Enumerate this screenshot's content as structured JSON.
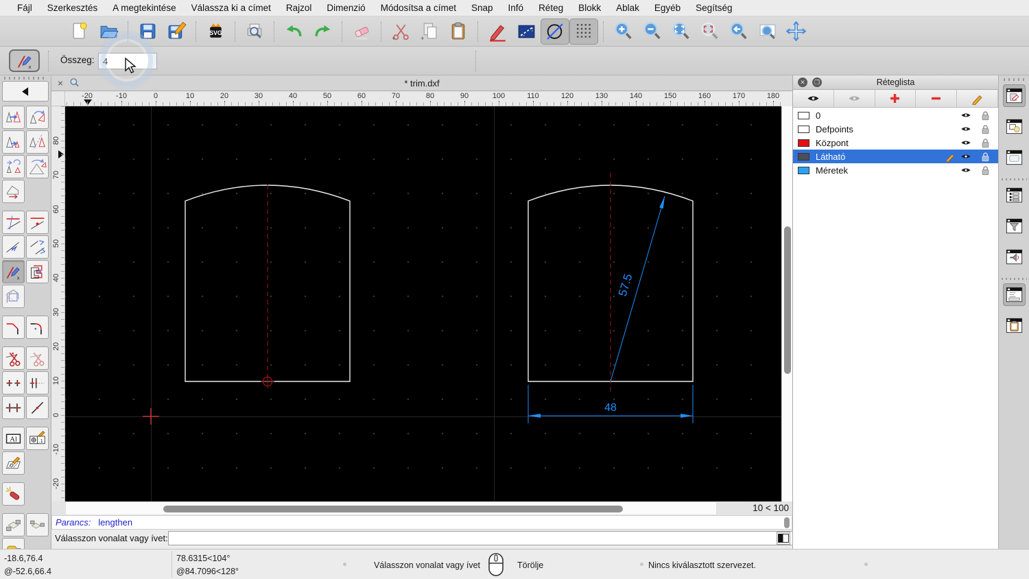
{
  "menu_items": [
    "Fájl",
    "Szerkesztés",
    "A megtekintése",
    "Válassza ki a címet",
    "Rajzol",
    "Dimenzió",
    "Módosítsa a címet",
    "Snap",
    "Infó",
    "Réteg",
    "Blokk",
    "Ablak",
    "Egyéb",
    "Segítség"
  ],
  "toolbar": {
    "icons": [
      "new",
      "open",
      "sep",
      "save",
      "save-as",
      "sep",
      "svg-export",
      "sep",
      "print-preview",
      "sep",
      "undo",
      "redo",
      "sep",
      "eraser",
      "sep",
      "cut",
      "copy",
      "paste",
      "sep",
      "pen",
      "measure",
      "draft-mode:pressed",
      "grid:pressed",
      "sep",
      "zoom-in",
      "zoom-out",
      "zoom-auto",
      "zoom-select",
      "zoom-previous",
      "zoom-window",
      "pan"
    ]
  },
  "tool_options": {
    "tool": "lengthen",
    "label": "Összeg:",
    "value": "4"
  },
  "tab_bar": {
    "title": "* trim.dxf",
    "close_glyph": "×"
  },
  "ruler_h": [
    "-20",
    "-10",
    "0",
    "10",
    "20",
    "30",
    "40",
    "50",
    "60",
    "70",
    "80",
    "90",
    "100",
    "110",
    "120",
    "130",
    "140",
    "150",
    "160",
    "170",
    "180"
  ],
  "ruler_v": [
    "80",
    "70",
    "60",
    "50",
    "40",
    "30",
    "20",
    "10",
    "0",
    "-10",
    "-20"
  ],
  "canvas": {
    "zoom_label": "10 < 100",
    "dim_diagonal": "57.5",
    "dim_width": "48"
  },
  "palette": {
    "rows": [
      [
        "move",
        "rotate"
      ],
      [
        "scale",
        "mirror"
      ],
      [
        "move-rotate",
        "rotate-two"
      ],
      [
        "revert-direction",
        null
      ],
      "gap",
      [
        "trim",
        "trim-two"
      ],
      [
        "lengthen-extend",
        "lengthen-both"
      ],
      [
        "lengthen:pressed",
        "offset"
      ],
      [
        "bevel-detail",
        null
      ],
      "gap",
      [
        "bevel",
        "fillet"
      ],
      "gap",
      [
        "divide",
        "divide-frozen"
      ],
      [
        "stretch",
        "stretch-two"
      ],
      [
        "stretch-three",
        "break-point"
      ],
      "gap",
      [
        "text-edit",
        "dim-edit"
      ],
      [
        "hatch-edit",
        null
      ],
      "gap",
      [
        "explode",
        null
      ],
      "gap",
      [
        "block-edit",
        "block-copy"
      ],
      [
        "paint",
        null
      ]
    ]
  },
  "layer_panel": {
    "title": "Réteglista",
    "toolbar_icons": [
      "eye-all",
      "eye-none",
      "add-layer",
      "remove-layer",
      "edit-layer"
    ],
    "layers": [
      {
        "name": "0",
        "color": "#ffffff",
        "selected": false,
        "pencil": false
      },
      {
        "name": "Defpoints",
        "color": "#ffffff",
        "selected": false,
        "pencil": false
      },
      {
        "name": "Központ",
        "color": "#e51010",
        "selected": false,
        "pencil": false
      },
      {
        "name": "Látható",
        "color": "#4a5058",
        "selected": true,
        "pencil": true
      },
      {
        "name": "Méretek",
        "color": "#29a3f3",
        "selected": false,
        "pencil": false
      }
    ]
  },
  "dock": {
    "buttons": [
      "dock-layers:pressed",
      "dock-blocks",
      "dock-library",
      "sep",
      "dock-list",
      "dock-filter",
      "dock-sound",
      "sep",
      "dock-command:pressed",
      "dock-clipboard"
    ]
  },
  "command": {
    "prefix": "Parancs:",
    "command": "lengthen",
    "prompt": "Válasszon vonalat vagy ívet:",
    "input_value": ""
  },
  "status": {
    "coord_abs": "-18.6,76.4",
    "coord_rel": "@-52.6,66.4",
    "angle_abs": "78.6315<104°",
    "angle_rel": "@84.7096<128°",
    "left_click": "Válasszon vonalat vagy ívet",
    "right_click": "Törölje",
    "selection": "Nincs kiválasztott szervezet."
  }
}
